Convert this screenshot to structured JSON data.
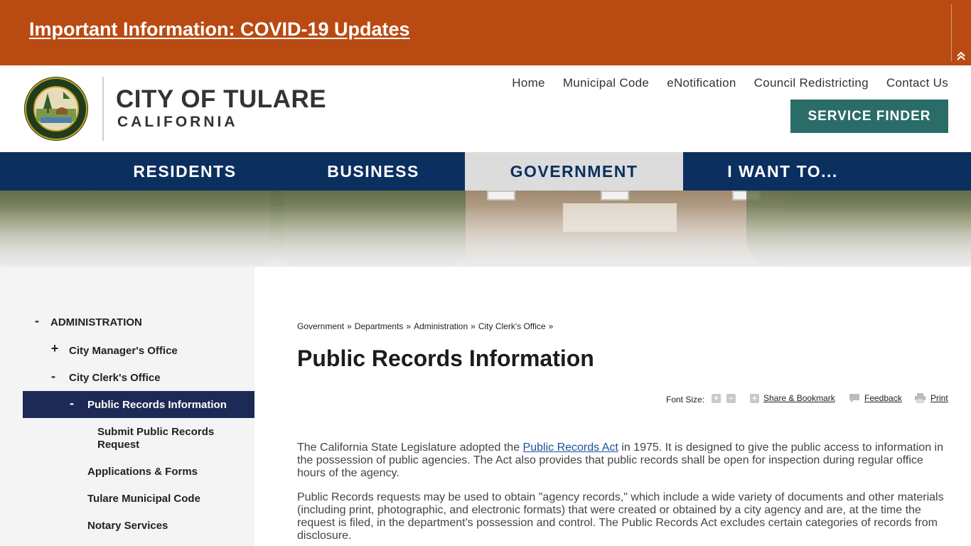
{
  "alert": {
    "link_text": "Important Information: COVID-19 Updates",
    "collapse_icon": "double-chevron-up-icon"
  },
  "header": {
    "seal_text_top": "CITY OF TULARE",
    "seal_text_bottom": "INCORPORATED APRIL 5 1888",
    "city_name": "CITY OF TULARE",
    "state_name": "CALIFORNIA",
    "utility_nav": [
      "Home",
      "Municipal Code",
      "eNotification",
      "Council Redistricting",
      "Contact Us"
    ],
    "service_finder_label": "SERVICE FINDER"
  },
  "main_nav": {
    "items": [
      "RESIDENTS",
      "BUSINESS",
      "GOVERNMENT",
      "I WANT TO..."
    ],
    "active": "GOVERNMENT"
  },
  "sidebar": {
    "items": [
      {
        "sign": "-",
        "label": "ADMINISTRATION"
      },
      {
        "sign": "+",
        "label": "City Manager's Office"
      },
      {
        "sign": "-",
        "label": "City Clerk's Office"
      },
      {
        "sign": "-",
        "label": "Public Records Information"
      },
      {
        "sign": "",
        "label": "Submit Public Records"
      },
      {
        "sign": "",
        "label": "Request"
      },
      {
        "sign": "",
        "label": "Applications & Forms"
      },
      {
        "sign": "",
        "label": "Tulare Municipal Code"
      },
      {
        "sign": "",
        "label": "Notary Services"
      }
    ]
  },
  "breadcrumb": [
    "Government",
    "Departments",
    "Administration",
    "City Clerk's Office"
  ],
  "breadcrumb_sep": "»",
  "page_title": "Public Records Information",
  "tools": {
    "font_size_label": "Font Size:",
    "increase": "+",
    "decrease": "−",
    "share_label": "Share & Bookmark",
    "feedback_label": "Feedback",
    "print_label": "Print"
  },
  "content": {
    "p1_before": "The California State Legislature adopted the ",
    "p1_link": "Public Records Act",
    "p1_after": " in 1975. It is designed to give the public access to information in the possession of public agencies. The Act also provides that public records shall be open for inspection during regular office hours of the agency.",
    "p2": "Public Records requests may be used to obtain \"agency records,\" which include a wide variety of documents and other materials (including print, photographic, and electronic formats) that were created or obtained by a city agency and are, at the time the request is filed, in the department's possession and control. The Public Records Act excludes certain categories of records from disclosure."
  },
  "colors": {
    "alert_bg": "#b94a12",
    "nav_bg": "#0b2f5f",
    "service_finder_bg": "#2a6c68",
    "sidebar_active_bg": "#1d2a55",
    "link": "#1d4f9e"
  }
}
